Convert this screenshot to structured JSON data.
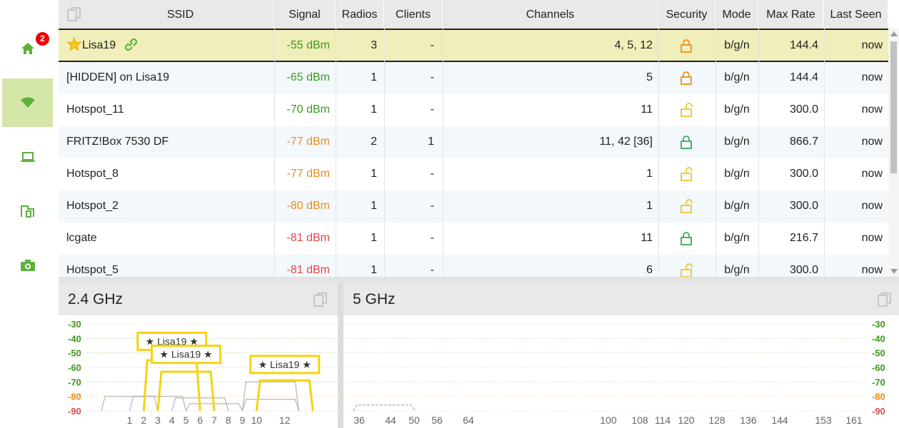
{
  "sidebar": {
    "items": [
      {
        "name": "home",
        "icon": "home-icon",
        "badge": "2"
      },
      {
        "name": "wifi",
        "icon": "wifi-icon",
        "active": true
      },
      {
        "name": "laptop",
        "icon": "laptop-icon"
      },
      {
        "name": "buildings",
        "icon": "building-icon"
      },
      {
        "name": "camera",
        "icon": "camera-icon"
      }
    ]
  },
  "table": {
    "headers": {
      "ssid": "SSID",
      "signal": "Signal",
      "radios": "Radios",
      "clients": "Clients",
      "channels": "Channels",
      "security": "Security",
      "mode": "Mode",
      "max_rate": "Max Rate",
      "last_seen": "Last Seen"
    },
    "rows": [
      {
        "ssid": "Lisa19",
        "signal": "-55 dBm",
        "signal_color": "green",
        "radios": "3",
        "clients": "-",
        "channels": "4, 5, 12",
        "security": "closed-orange",
        "mode": "b/g/n",
        "max_rate": "144.4",
        "last_seen": "now",
        "favorite": true,
        "linked": true
      },
      {
        "ssid": "[HIDDEN] on Lisa19",
        "signal": "-65 dBm",
        "signal_color": "green",
        "radios": "1",
        "clients": "-",
        "channels": "5",
        "security": "closed-orange",
        "mode": "b/g/n",
        "max_rate": "144.4",
        "last_seen": "now"
      },
      {
        "ssid": "Hotspot_11",
        "signal": "-70 dBm",
        "signal_color": "green",
        "radios": "1",
        "clients": "-",
        "channels": "11",
        "security": "open-yellow",
        "mode": "b/g/n",
        "max_rate": "300.0",
        "last_seen": "now"
      },
      {
        "ssid": "FRITZ!Box 7530 DF",
        "signal": "-77 dBm",
        "signal_color": "orange",
        "radios": "2",
        "clients": "1",
        "channels": "11, 42 [36]",
        "security": "closed-green",
        "mode": "b/g/n",
        "max_rate": "866.7",
        "last_seen": "now"
      },
      {
        "ssid": "Hotspot_8",
        "signal": "-77 dBm",
        "signal_color": "orange",
        "radios": "1",
        "clients": "-",
        "channels": "1",
        "security": "open-yellow",
        "mode": "b/g/n",
        "max_rate": "300.0",
        "last_seen": "now"
      },
      {
        "ssid": "Hotspot_2",
        "signal": "-80 dBm",
        "signal_color": "orange",
        "radios": "1",
        "clients": "-",
        "channels": "1",
        "security": "open-yellow",
        "mode": "b/g/n",
        "max_rate": "300.0",
        "last_seen": "now"
      },
      {
        "ssid": "lcgate",
        "signal": "-81 dBm",
        "signal_color": "red",
        "radios": "1",
        "clients": "-",
        "channels": "11",
        "security": "closed-green",
        "mode": "b/g/n",
        "max_rate": "216.7",
        "last_seen": "now"
      },
      {
        "ssid": "Hotspot_5",
        "signal": "-81 dBm",
        "signal_color": "red",
        "radios": "1",
        "clients": "-",
        "channels": "6",
        "security": "open-yellow",
        "mode": "b/g/n",
        "max_rate": "300.0",
        "last_seen": "now"
      }
    ]
  },
  "colors": {
    "green": "#3d9a1a",
    "orange": "#ef8a18",
    "red": "#e0474b",
    "accent_active": "#d3e6a7",
    "selected_row": "#f0eeba",
    "highlight": "#f5d40f",
    "lock_orange": "#f0901a",
    "lock_yellow": "#f2c230",
    "lock_green": "#3aa862"
  },
  "panels": {
    "ghz24": {
      "title": "2.4 GHz"
    },
    "ghz5": {
      "title": "5 GHz"
    }
  },
  "chart_data": [
    {
      "type": "area",
      "title": "2.4 GHz",
      "y_ticks": [
        "-30",
        "-40",
        "-50",
        "-60",
        "-70",
        "-80",
        "-90"
      ],
      "y_tick_colors": [
        "green",
        "green",
        "green",
        "green",
        "green",
        "orange",
        "red"
      ],
      "ylim": [
        -90,
        -30
      ],
      "x_ticks": [
        "1",
        "2",
        "3",
        "4",
        "5",
        "6",
        "7",
        "8",
        "9",
        "10",
        "12"
      ],
      "x_tick_values": [
        1,
        2,
        3,
        4,
        5,
        6,
        7,
        8,
        9,
        10,
        12
      ],
      "xlim": [
        -1,
        15
      ],
      "highlight_label": "★ Lisa19 ★",
      "networks": [
        {
          "center": 4,
          "width": 4,
          "dbm": -55,
          "highlight": true
        },
        {
          "center": 5,
          "width": 4,
          "dbm": -63,
          "highlight": true
        },
        {
          "center": 12,
          "width": 4,
          "dbm": -69,
          "highlight": true
        },
        {
          "center": 11,
          "width": 4,
          "dbm": -70,
          "highlight": false
        },
        {
          "center": 3,
          "width": 4,
          "dbm": -80,
          "highlight": false
        },
        {
          "center": 1,
          "width": 4,
          "dbm": -80,
          "highlight": false
        },
        {
          "center": 6,
          "width": 4,
          "dbm": -81,
          "highlight": false
        },
        {
          "center": 11,
          "width": 4,
          "dbm": -82,
          "highlight": false
        },
        {
          "center": 7,
          "width": 4,
          "dbm": -85,
          "highlight": false
        }
      ],
      "labels": [
        {
          "text": "★ Lisa19 ★",
          "center": 4,
          "dbm": -42
        },
        {
          "text": "★ Lisa19 ★",
          "center": 5,
          "dbm": -51
        },
        {
          "text": "★ Lisa19 ★",
          "center": 12,
          "dbm": -58
        }
      ]
    },
    {
      "type": "area",
      "title": "5 GHz",
      "y_ticks": [
        "-30",
        "-40",
        "-50",
        "-60",
        "-70",
        "-80",
        "-90"
      ],
      "ylim": [
        -90,
        -30
      ],
      "x_ticks": [
        "36",
        "44",
        "50",
        "56",
        "64",
        "100",
        "108",
        "114",
        "120",
        "128",
        "136",
        "144",
        "153",
        "161"
      ],
      "x_tick_values": [
        36,
        44,
        50,
        56,
        64,
        100,
        108,
        114,
        120,
        128,
        136,
        144,
        153,
        161
      ],
      "networks": [
        {
          "center": 42,
          "width": 16,
          "dbm": -86,
          "highlight": false,
          "dashed": true
        }
      ]
    }
  ]
}
